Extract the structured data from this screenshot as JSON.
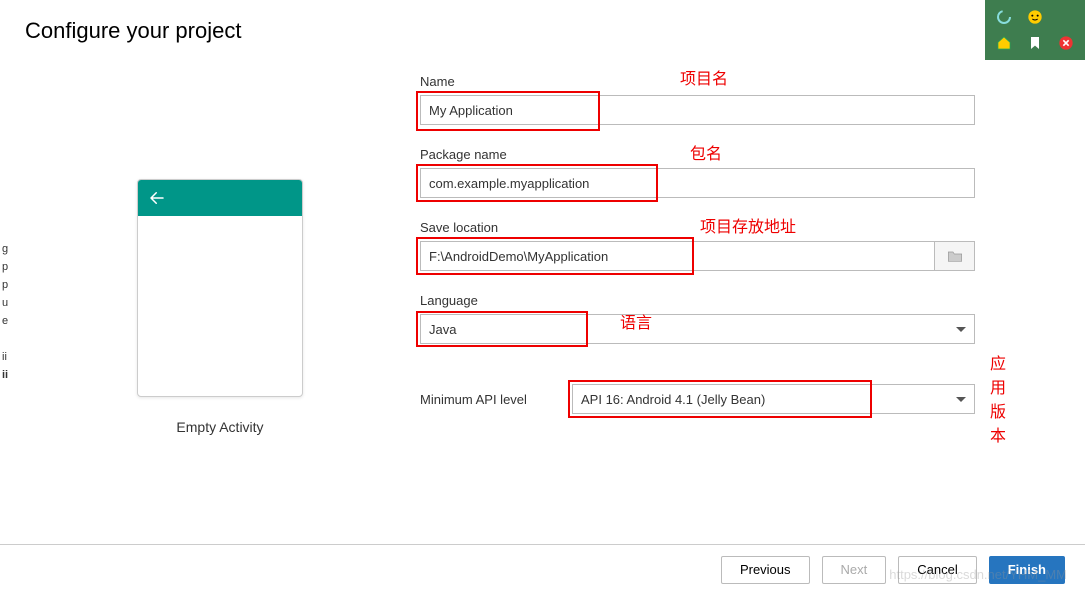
{
  "title": "Configure your project",
  "preview": {
    "label": "Empty Activity"
  },
  "form": {
    "name": {
      "label": "Name",
      "value": "My Application",
      "annotation": "项目名"
    },
    "package": {
      "label": "Package name",
      "value": "com.example.myapplication",
      "annotation": "包名"
    },
    "location": {
      "label": "Save location",
      "value": "F:\\AndroidDemo\\MyApplication",
      "annotation": "项目存放地址"
    },
    "language": {
      "label": "Language",
      "value": "Java",
      "annotation": "语言"
    },
    "api": {
      "label": "Minimum API level",
      "value": "API 16: Android 4.1 (Jelly Bean)",
      "annotation": "应用版本"
    }
  },
  "buttons": {
    "previous": "Previous",
    "next": "Next",
    "cancel": "Cancel",
    "finish": "Finish"
  }
}
